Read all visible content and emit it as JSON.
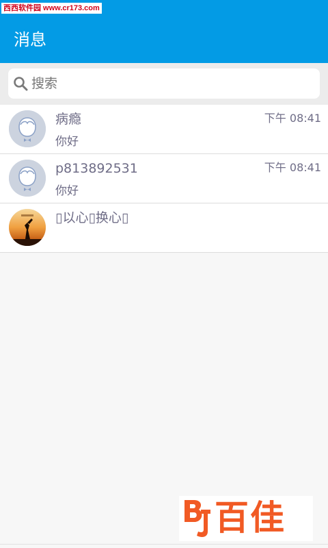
{
  "watermark": {
    "text": "西西软件园 www.cr173.com"
  },
  "header": {
    "title": "消息"
  },
  "search": {
    "placeholder": "搜索",
    "icon": "search-icon"
  },
  "conversations": [
    {
      "name": "病瘾",
      "time": "下午 08:41",
      "preview": "你好",
      "avatar": "default-avatar-icon"
    },
    {
      "name": "p813892531",
      "time": "下午 08:41",
      "preview": "你好",
      "avatar": "default-avatar-icon"
    },
    {
      "name": "▯以心▯换心▯",
      "time": "",
      "preview": "",
      "avatar": "sunset-photo-avatar"
    }
  ],
  "logo": {
    "text": "百佳",
    "mark": "BJ"
  },
  "colors": {
    "accent": "#039be5",
    "text_secondary": "#6f6d87",
    "logo": "#f15a24"
  }
}
